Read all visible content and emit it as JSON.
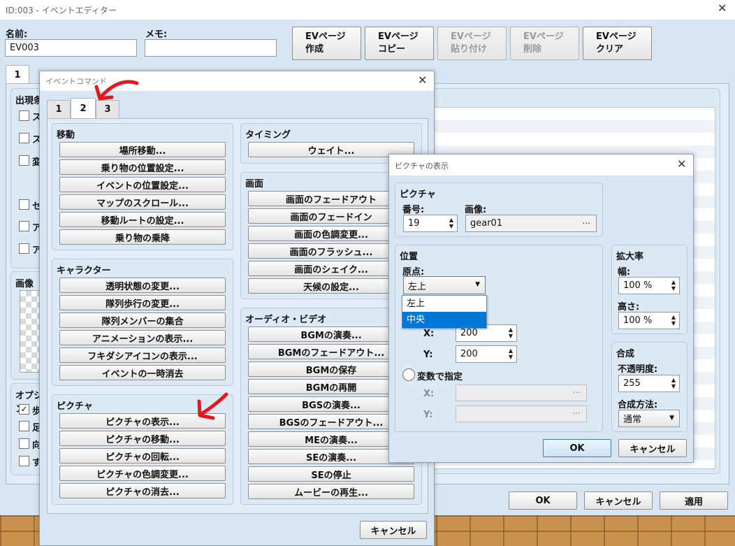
{
  "main": {
    "title": "ID:003 - イベントエディター",
    "name_label": "名前:",
    "name_value": "EV003",
    "memo_label": "メモ:",
    "memo_value": "",
    "page_buttons": [
      {
        "line1": "EVページ",
        "line2": "作成"
      },
      {
        "line1": "EVページ",
        "line2": "コピー"
      },
      {
        "line1": "EVページ",
        "line2": "貼り付け"
      },
      {
        "line1": "EVページ",
        "line2": "削除"
      },
      {
        "line1": "EVページ",
        "line2": "クリア"
      }
    ],
    "page_tab": "1",
    "conditions_title": "出現条件",
    "condition_items": [
      "ス",
      "ス",
      "変",
      "セ",
      "ア",
      "ア"
    ],
    "image_title": "画像",
    "options_title": "オプション",
    "option_items": [
      "歩",
      "足",
      "向",
      "す"
    ],
    "ok": "OK",
    "cancel": "キャンセル",
    "apply": "適用"
  },
  "cmd": {
    "title": "イベントコマンド",
    "tabs": [
      "1",
      "2",
      "3"
    ],
    "active_tab": "2",
    "groups": {
      "move": {
        "title": "移動",
        "items": [
          "場所移動...",
          "乗り物の位置設定...",
          "イベントの位置設定...",
          "マップのスクロール...",
          "移動ルートの設定...",
          "乗り物の乗降"
        ]
      },
      "character": {
        "title": "キャラクター",
        "items": [
          "透明状態の変更...",
          "隊列歩行の変更...",
          "隊列メンバーの集合",
          "アニメーションの表示...",
          "フキダシアイコンの表示...",
          "イベントの一時消去"
        ]
      },
      "picture": {
        "title": "ピクチャ",
        "items": [
          "ピクチャの表示...",
          "ピクチャの移動...",
          "ピクチャの回転...",
          "ピクチャの色調変更...",
          "ピクチャの消去..."
        ]
      },
      "timing": {
        "title": "タイミング",
        "items": [
          "ウェイト..."
        ]
      },
      "screen": {
        "title": "画面",
        "items": [
          "画面のフェードアウト",
          "画面のフェードイン",
          "画面の色調変更...",
          "画面のフラッシュ...",
          "画面のシェイク...",
          "天候の設定..."
        ]
      },
      "audio": {
        "title": "オーディオ・ビデオ",
        "items": [
          "BGMの演奏...",
          "BGMのフェードアウト...",
          "BGMの保存",
          "BGMの再開",
          "BGSの演奏...",
          "BGSのフェードアウト...",
          "MEの演奏...",
          "SEの演奏...",
          "SEの停止",
          "ムービーの再生..."
        ]
      }
    },
    "cancel": "キャンセル"
  },
  "pic": {
    "title": "ピクチャの表示",
    "picture_title": "ピクチャ",
    "number_label": "番号:",
    "number_value": "19",
    "image_label": "画像:",
    "image_value": "gear01",
    "position_title": "位置",
    "origin_label": "原点:",
    "origin_value": "左上",
    "origin_options": [
      "左上",
      "中央"
    ],
    "origin_highlighted": "中央",
    "x_label": "X:",
    "x_value": "200",
    "y_label": "Y:",
    "y_value": "200",
    "var_label": "変数で指定",
    "var_x_label": "X:",
    "var_y_label": "Y:",
    "scale_title": "拡大率",
    "width_label": "幅:",
    "width_value": "100 %",
    "height_label": "高さ:",
    "height_value": "100 %",
    "blend_title": "合成",
    "opacity_label": "不透明度:",
    "opacity_value": "255",
    "blend_mode_label": "合成方法:",
    "blend_mode_value": "通常",
    "ok": "OK",
    "cancel": "キャンセル"
  },
  "colors": {
    "window_bg": "#d8e6f3",
    "panel_bg": "#dce8f4",
    "highlight": "#0078d7",
    "arrow_red": "#e8141e"
  }
}
